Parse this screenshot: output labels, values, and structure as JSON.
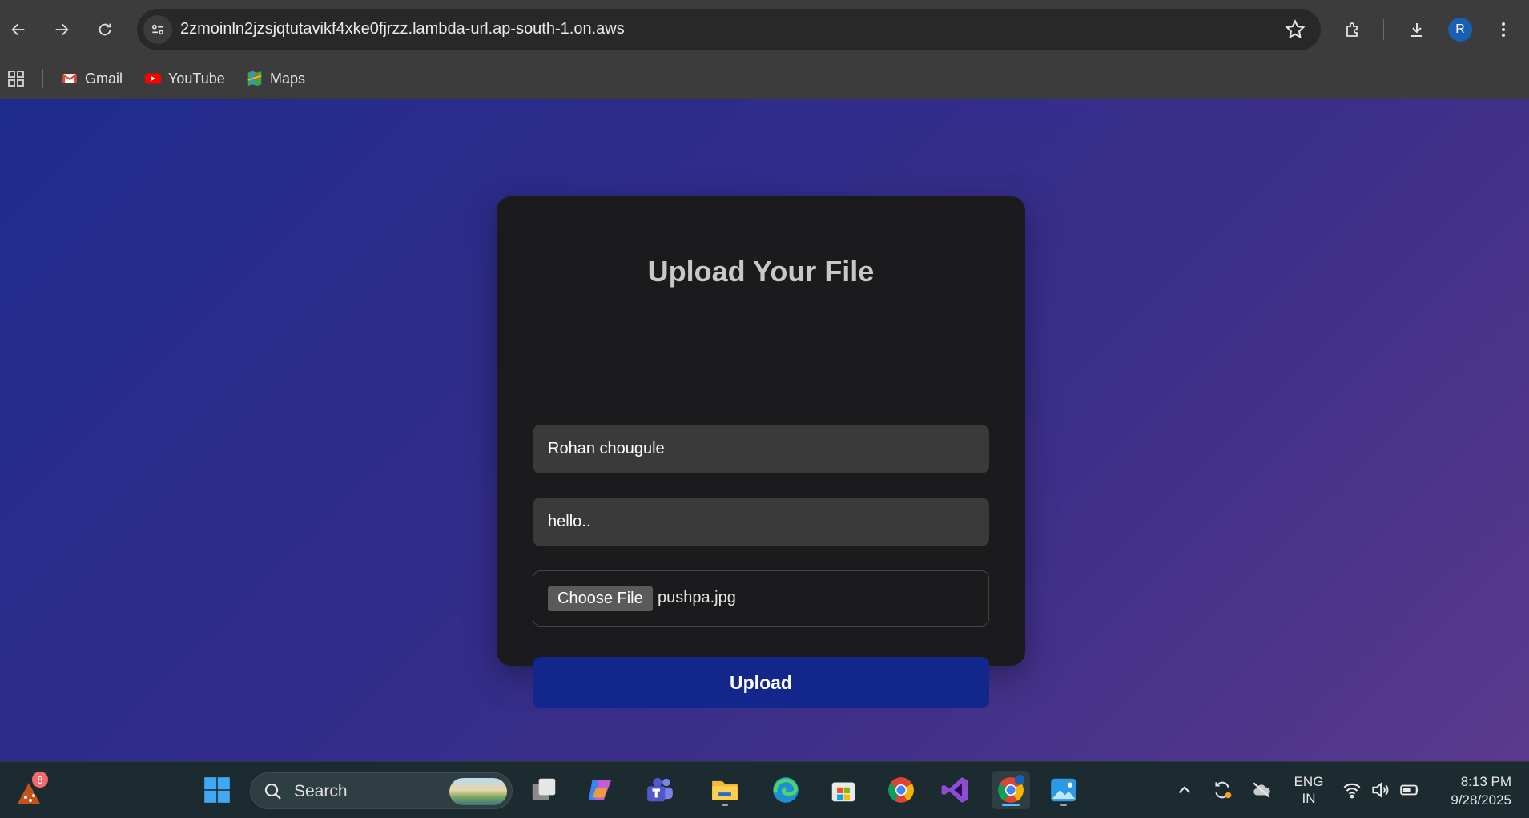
{
  "browser": {
    "url": "2zmoinln2jzsjqtutavikf4xke0fjrzz.lambda-url.ap-south-1.on.aws",
    "profile_initial": "R",
    "nav": {
      "back_icon": "arrow-left-icon",
      "forward_icon": "arrow-right-icon",
      "reload_icon": "reload-icon"
    },
    "bookmarks": [
      {
        "label": "Gmail",
        "icon": "gmail-icon"
      },
      {
        "label": "YouTube",
        "icon": "youtube-icon"
      },
      {
        "label": "Maps",
        "icon": "maps-icon"
      }
    ]
  },
  "form": {
    "title": "Upload Your File",
    "name_value": "Rohan chougule",
    "message_value": "hello..",
    "choose_file_label": "Choose File",
    "file_name": "pushpa.jpg",
    "upload_label": "Upload"
  },
  "taskbar": {
    "weather_badge": "8",
    "search_label": "Search",
    "apps": [
      "start",
      "task-view",
      "copilot",
      "teams",
      "file-explorer",
      "edge",
      "microsoft-store",
      "chrome",
      "visual-studio",
      "chrome-profile",
      "photos"
    ],
    "language_line1": "ENG",
    "language_line2": "IN",
    "time": "8:13 PM",
    "date": "9/28/2025"
  },
  "colors": {
    "upload_button": "#13268c",
    "card_bg": "#1b1b1d",
    "gradient_start": "#1e2c8c",
    "gradient_end": "#5a3a8c"
  }
}
